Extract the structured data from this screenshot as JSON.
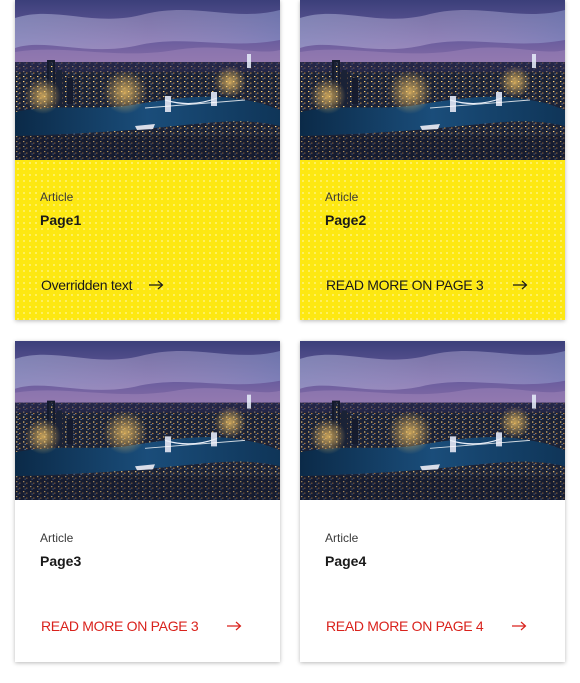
{
  "cards": [
    {
      "type": "Article",
      "title": "Page1",
      "link": "Overridden text",
      "style": "yellow"
    },
    {
      "type": "Article",
      "title": "Page2",
      "link": "READ MORE ON PAGE 3",
      "style": "yellow"
    },
    {
      "type": "Article",
      "title": "Page3",
      "link": "READ MORE ON PAGE 3",
      "style": "white"
    },
    {
      "type": "Article",
      "title": "Page4",
      "link": "READ MORE ON PAGE 4",
      "style": "white"
    }
  ],
  "colors": {
    "card_yellow": "#fde812",
    "link_red": "#d9221c"
  },
  "icons": {
    "link_arrow": "arrow-right-icon"
  }
}
